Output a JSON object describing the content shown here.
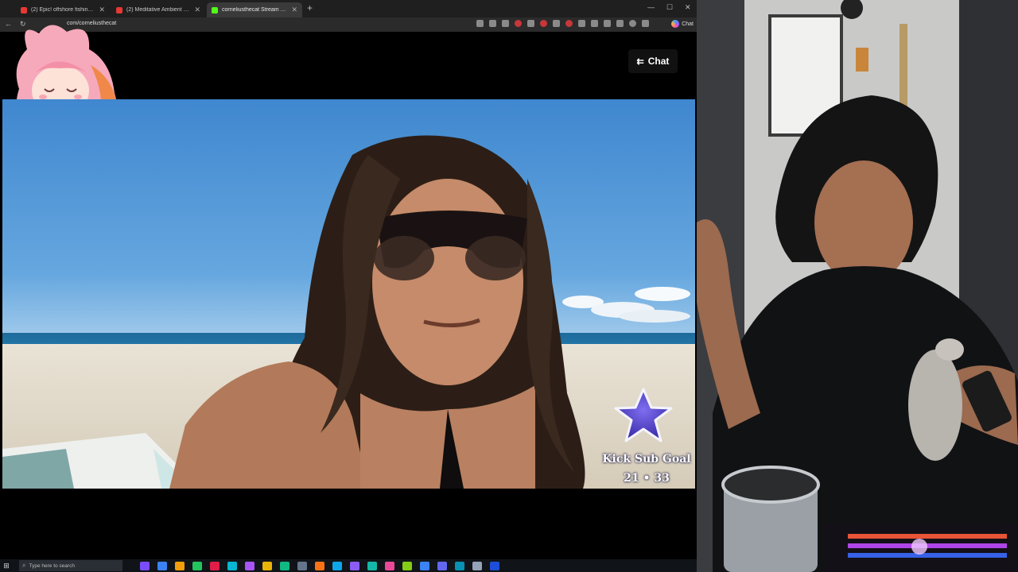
{
  "browser": {
    "tabs": [
      {
        "label": "(2) Epic! offshore fishing with ber",
        "favicon_color": "#e53935"
      },
      {
        "label": "(2) Meditative Ambient Club Tech",
        "favicon_color": "#e53935"
      },
      {
        "label": "corneliusthecat Stream - Wat",
        "favicon_color": "#53fc18",
        "active": true
      }
    ],
    "new_tab_label": "+",
    "url": "com/corneliusthecat",
    "copilot_label": "Chat"
  },
  "page": {
    "chat_button_label": "Chat"
  },
  "overlay": {
    "sub_goal_title": "Kick Sub Goal",
    "sub_goal_count": "21 • 33"
  },
  "taskbar": {
    "search_placeholder": "Type here to search",
    "apps": [
      "#7a4cff",
      "#3b82f6",
      "#f59e0b",
      "#22c55e",
      "#e11d48",
      "#06b6d4",
      "#a855f7",
      "#eab308",
      "#10b981",
      "#64748b",
      "#f97316",
      "#0ea5e9",
      "#8b5cf6",
      "#14b8a6",
      "#ec4899",
      "#84cc16",
      "#3b82f6",
      "#6366f1",
      "#0891b2",
      "#94a3b8",
      "#1d4ed8"
    ]
  },
  "colors": {
    "kick_green": "#53fc18",
    "goal_star": "#5a3fd6"
  }
}
